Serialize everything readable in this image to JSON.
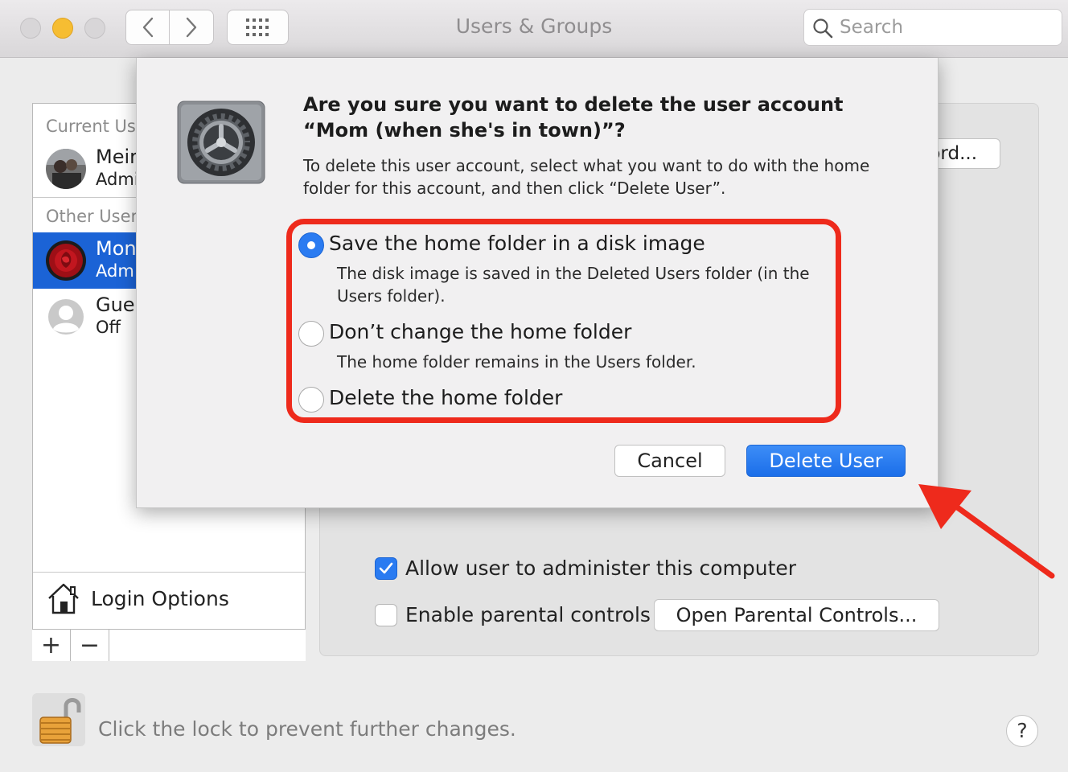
{
  "window": {
    "title": "Users & Groups",
    "search_placeholder": "Search"
  },
  "colors": {
    "accent": "#1b63d6",
    "annotation_red": "#ee2a1c"
  },
  "sidebar": {
    "current_users_header": "Current Us",
    "other_users_header": "Other User",
    "current_user": {
      "name": "Meir",
      "role": "Admi"
    },
    "other_users": [
      {
        "name": "Mon",
        "role": "Adm",
        "selected": true
      },
      {
        "name": "Gue",
        "role": "Off",
        "selected": false
      }
    ],
    "login_options": "Login Options",
    "add_label": "+",
    "remove_label": "−"
  },
  "detail": {
    "password_button": "ord...",
    "allow_admin_label": "Allow user to administer this computer",
    "allow_admin_checked": true,
    "parental_label": "Enable parental controls",
    "parental_checked": false,
    "parental_button": "Open Parental Controls..."
  },
  "footer": {
    "lock_text": "Click the lock to prevent further changes.",
    "help_label": "?"
  },
  "dialog": {
    "title": "Are you sure you want to delete the user account “Mom (when she's in town)”?",
    "description": "To delete this user account, select what you want to do with the home folder for this account, and then click “Delete User”.",
    "options": [
      {
        "label": "Save the home folder in a disk image",
        "sub": "The disk image is saved in the Deleted Users folder (in the Users folder).",
        "selected": true
      },
      {
        "label": "Don’t change the home folder",
        "sub": "The home folder remains in the Users folder.",
        "selected": false
      },
      {
        "label": "Delete the home folder",
        "sub": "",
        "selected": false
      }
    ],
    "cancel_label": "Cancel",
    "delete_label": "Delete User"
  },
  "icons": [
    "back-chevron-icon",
    "forward-chevron-icon",
    "grid-icon",
    "search-icon",
    "gear-icon",
    "house-icon",
    "lock-icon",
    "arrow-annotation-icon"
  ]
}
